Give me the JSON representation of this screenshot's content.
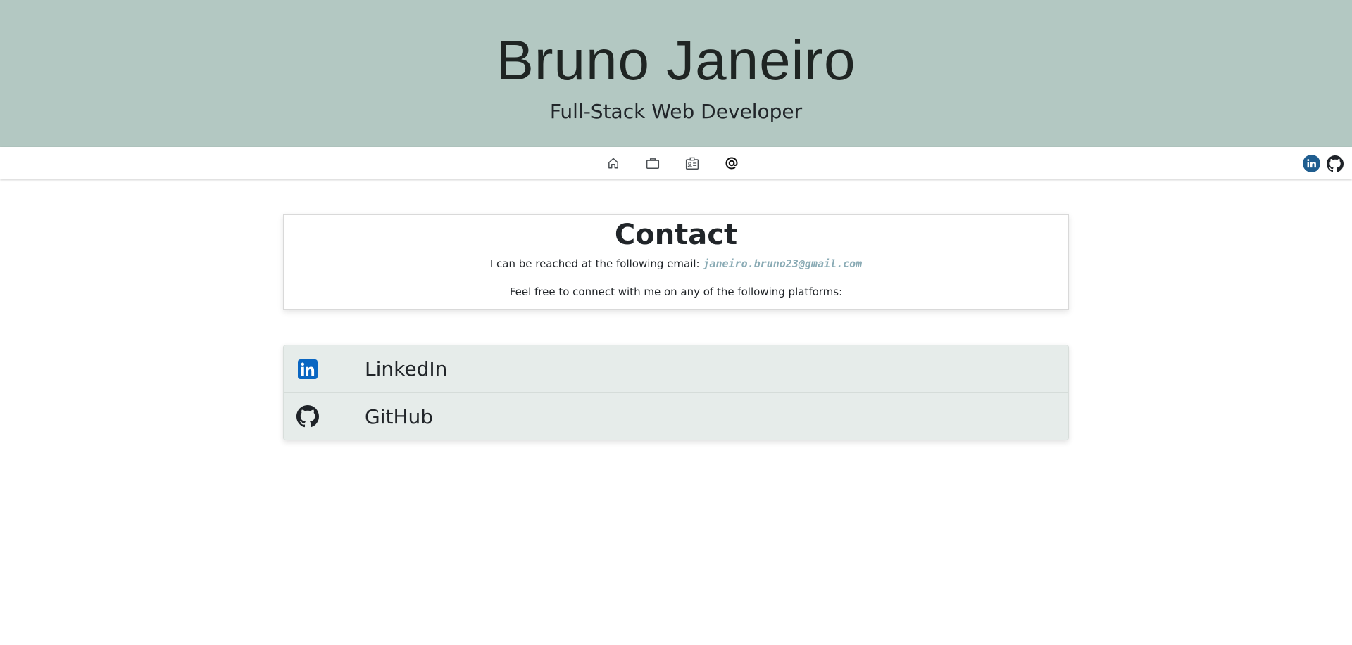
{
  "header": {
    "name": "Bruno Janeiro",
    "role": "Full-Stack Web Developer",
    "background_color": "#b3c8c2"
  },
  "nav": {
    "items": [
      {
        "icon": "home-icon"
      },
      {
        "icon": "briefcase-icon"
      },
      {
        "icon": "id-card-icon"
      },
      {
        "icon": "at-sign-icon"
      }
    ],
    "social": [
      {
        "icon": "linkedin-icon"
      },
      {
        "icon": "github-icon"
      }
    ]
  },
  "contact": {
    "title": "Contact",
    "email_intro": "I can be reached at the following email: ",
    "email": "janeiro.bruno23@gmail.com",
    "platforms_intro": "Feel free to connect with me on any of the following platforms:",
    "email_color": "#8aabb5"
  },
  "platforms": [
    {
      "label": "LinkedIn",
      "icon": "linkedin-icon",
      "color": "#0a66c2"
    },
    {
      "label": "GitHub",
      "icon": "github-icon",
      "color": "#1f2328"
    }
  ]
}
